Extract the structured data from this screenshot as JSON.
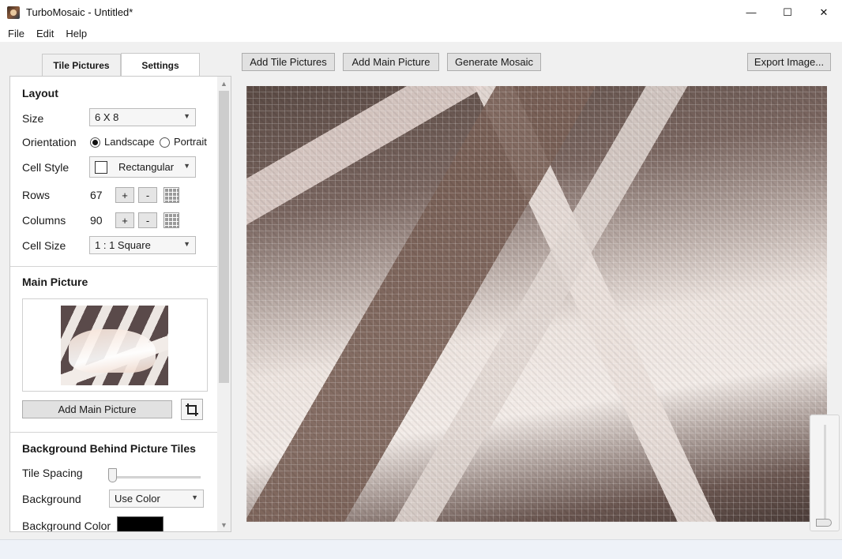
{
  "window": {
    "title": "TurboMosaic - Untitled*",
    "minimize": "—",
    "maximize": "☐",
    "close": "✕"
  },
  "menu": [
    "File",
    "Edit",
    "Help"
  ],
  "tabs": {
    "tile_pictures": "Tile Pictures",
    "settings": "Settings"
  },
  "toolbar": {
    "add_tile_pictures": "Add Tile Pictures",
    "add_main_picture": "Add Main Picture",
    "generate_mosaic": "Generate Mosaic",
    "export_image": "Export Image..."
  },
  "layout": {
    "title": "Layout",
    "size_label": "Size",
    "size_value": "6 X 8",
    "orientation_label": "Orientation",
    "orientation_landscape": "Landscape",
    "orientation_portrait": "Portrait",
    "orientation_selected": "Landscape",
    "cell_style_label": "Cell Style",
    "cell_style_value": "Rectangular",
    "rows_label": "Rows",
    "rows_value": "67",
    "columns_label": "Columns",
    "columns_value": "90",
    "plus": "+",
    "minus": "-",
    "cell_size_label": "Cell Size",
    "cell_size_value": "1 : 1 Square"
  },
  "main_picture": {
    "title": "Main Picture",
    "add_button": "Add Main Picture"
  },
  "background": {
    "title": "Background Behind Picture Tiles",
    "tile_spacing_label": "Tile Spacing",
    "tile_spacing_value": 0,
    "background_label": "Background",
    "background_value": "Use Color",
    "background_color_label": "Background Color",
    "background_color": "#000000"
  },
  "zoom_level": 0
}
